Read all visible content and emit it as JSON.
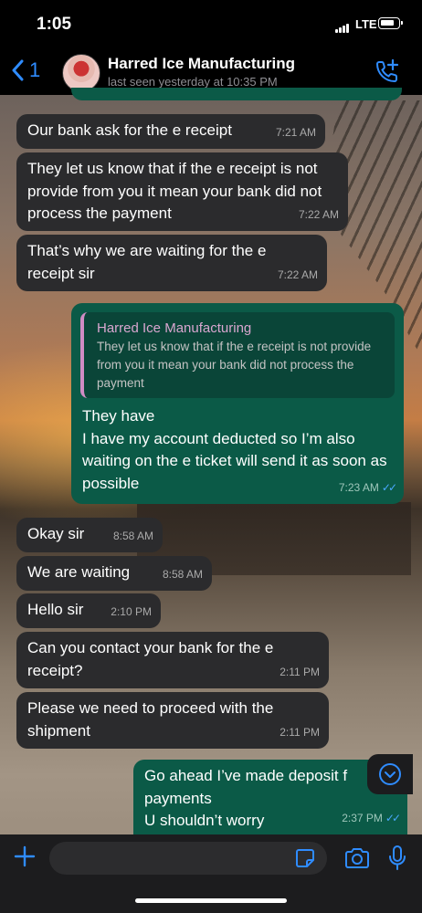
{
  "status_bar": {
    "time": "1:05",
    "network": "LTE"
  },
  "header": {
    "back_count": "1",
    "contact_name": "Harred Ice Manufacturing",
    "last_seen": "last seen yesterday at 10:35 PM"
  },
  "messages": [
    {
      "direction": "in",
      "text": "Our bank ask for the e receipt",
      "time": "7:21 AM"
    },
    {
      "direction": "in",
      "text": "They let us know that if the e receipt is not provide from you it mean your bank did not process the payment",
      "time": "7:22 AM"
    },
    {
      "direction": "in",
      "text": "That’s why we are waiting for the e receipt sir",
      "time": "7:22 AM"
    },
    {
      "direction": "out",
      "quote": {
        "name": "Harred Ice Manufacturing",
        "text": "They let us know that if the e receipt is not provide from you it mean your bank did not process the payment"
      },
      "text": "They have\nI have my account deducted so I’m also waiting on the e ticket will send it as soon as possible",
      "time": "7:23 AM"
    },
    {
      "direction": "in",
      "text": "Okay sir",
      "time": "8:58 AM"
    },
    {
      "direction": "in",
      "text": "We are waiting",
      "time": "8:58 AM"
    },
    {
      "direction": "in",
      "text": "Hello sir",
      "time": "2:10 PM"
    },
    {
      "direction": "in",
      "text": "Can you contact your bank for the e receipt?",
      "time": "2:11 PM"
    },
    {
      "direction": "in",
      "text": "Please we need to proceed with the shipment",
      "time": "2:11 PM"
    },
    {
      "direction": "out",
      "text": "Go ahead I’ve made deposit f payments\nU shouldn’t worry",
      "time": "2:37 PM"
    }
  ],
  "input_bar": {
    "value": ""
  },
  "colors": {
    "accent": "#2f8cff",
    "incoming_bubble": "#2b2b2d",
    "outgoing_bubble": "#0b5a47",
    "read_ticks": "#4aa9ff"
  }
}
